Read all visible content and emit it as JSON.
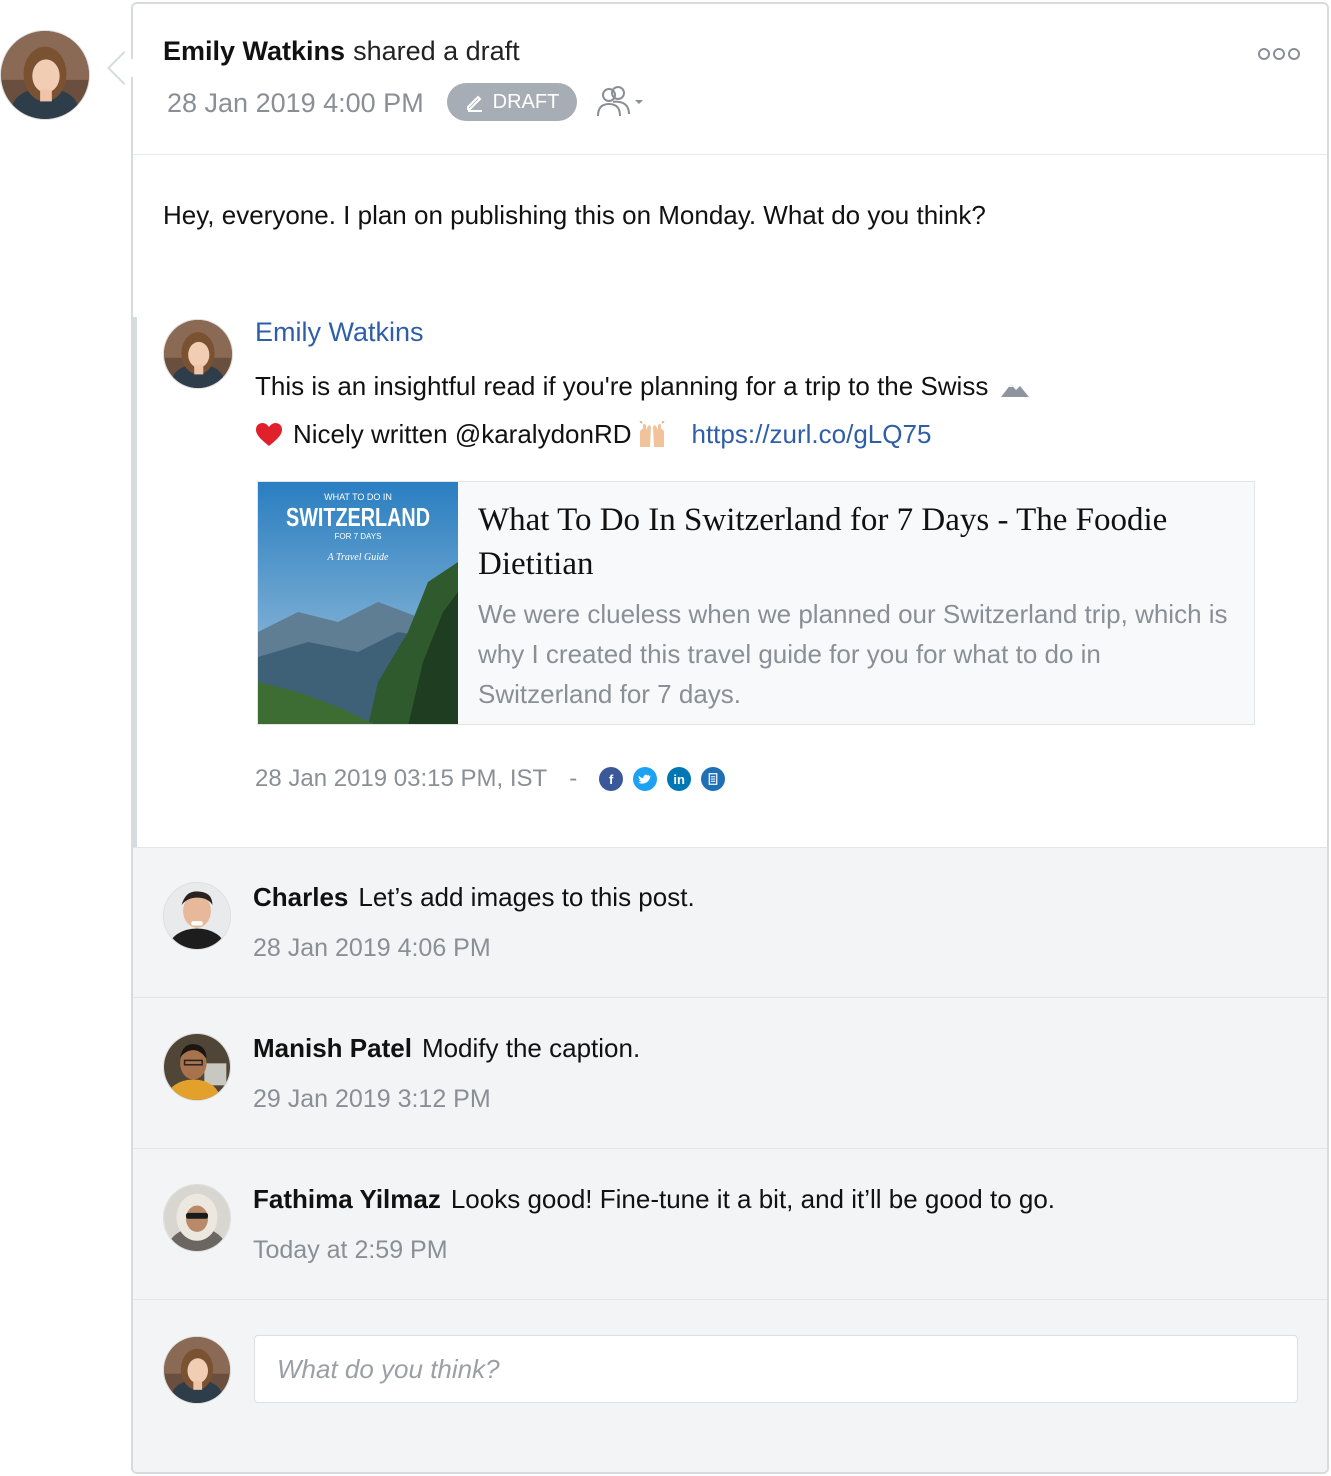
{
  "post": {
    "author": "Emily Watkins",
    "action": "shared a draft",
    "timestamp": "28 Jan 2019 4:00 PM",
    "badge": "DRAFT",
    "message": "Hey, everyone. I plan on publishing this on Monday. What do you think?"
  },
  "shared": {
    "author": "Emily Watkins",
    "text_line1": "This is an insightful read if you're planning for a trip to the Swiss",
    "text_line2": "Nicely written @karalydonRD",
    "link": "https://zurl.co/gLQ75",
    "preview": {
      "thumb_kicker": "WHAT TO DO IN",
      "thumb_title": "SWITZERLAND",
      "thumb_sub": "FOR 7 DAYS",
      "thumb_script": "A Travel Guide",
      "title": "What To Do In Switzerland for 7 Days - The Foodie Dietitian",
      "description": "We were clueless when we planned our Switzerland trip, which is why I created this travel guide for you for what to do in Switzerland for 7 days."
    },
    "meta_time": "28 Jan 2019 03:15 PM, IST",
    "meta_sep": "-",
    "social_icons": [
      "facebook-icon",
      "twitter-icon",
      "linkedin-icon",
      "document-icon"
    ]
  },
  "comments": [
    {
      "name": "Charles",
      "text": "Let’s add images to this post.",
      "time": "28 Jan 2019 4:06 PM"
    },
    {
      "name": "Manish Patel",
      "text": "Modify the caption.",
      "time": "29 Jan 2019 3:12 PM"
    },
    {
      "name": "Fathima Yilmaz",
      "text": "Looks good! Fine-tune it a bit, and it’ll be good to go.",
      "time": "Today at 2:59 PM"
    }
  ],
  "reply": {
    "placeholder": "What do you think?"
  },
  "colors": {
    "link": "#2f5ea8",
    "muted": "#8a8f96",
    "badge": "#a7adb4",
    "facebook": "#3b5998",
    "twitter": "#1da1f2",
    "linkedin": "#0077b5",
    "doc": "#1f6fb5"
  }
}
